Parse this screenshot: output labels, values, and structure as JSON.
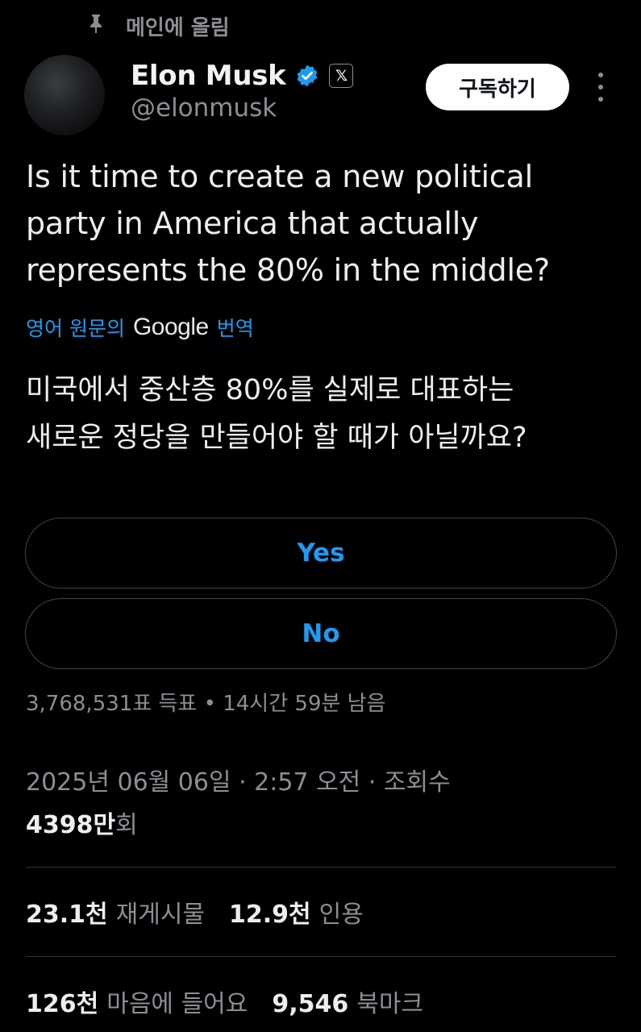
{
  "pinned": {
    "label": "메인에 올림"
  },
  "author": {
    "name": "Elon Musk",
    "handle": "@elonmusk",
    "affiliate_glyph": "𝕏"
  },
  "actions": {
    "subscribe_label": "구독하기"
  },
  "tweet": {
    "text": "Is it time to create a new political\nparty in America that actually\nrepresents the 80% in the middle?"
  },
  "translation": {
    "prefix": "영어 원문의",
    "provider": "Google",
    "suffix": "번역",
    "text": "미국에서 중산층 80%를 실제로 대표하는\n새로운 정당을 만들어야 할 때가 아닐까요?"
  },
  "poll": {
    "options": [
      "Yes",
      "No"
    ],
    "meta": "3,768,531표 득표 • 14시간 59분 남음"
  },
  "timestamp": "2025년 06월 06일 · 2:57 오전 · 조회수",
  "views": {
    "value": "4398만",
    "label": "회"
  },
  "stats": {
    "reposts": {
      "value": "23.1천",
      "label": "재게시물"
    },
    "quotes": {
      "value": "12.9천",
      "label": "인용"
    },
    "likes": {
      "value": "126천",
      "label": "마음에 들어요"
    },
    "bookmarks": {
      "value": "9,546",
      "label": "북마크"
    }
  },
  "colors": {
    "background": "#000000",
    "accent": "#1d9bf0",
    "muted": "#8b8f94",
    "text": "#e7e9ea",
    "divider": "#2f3336"
  }
}
